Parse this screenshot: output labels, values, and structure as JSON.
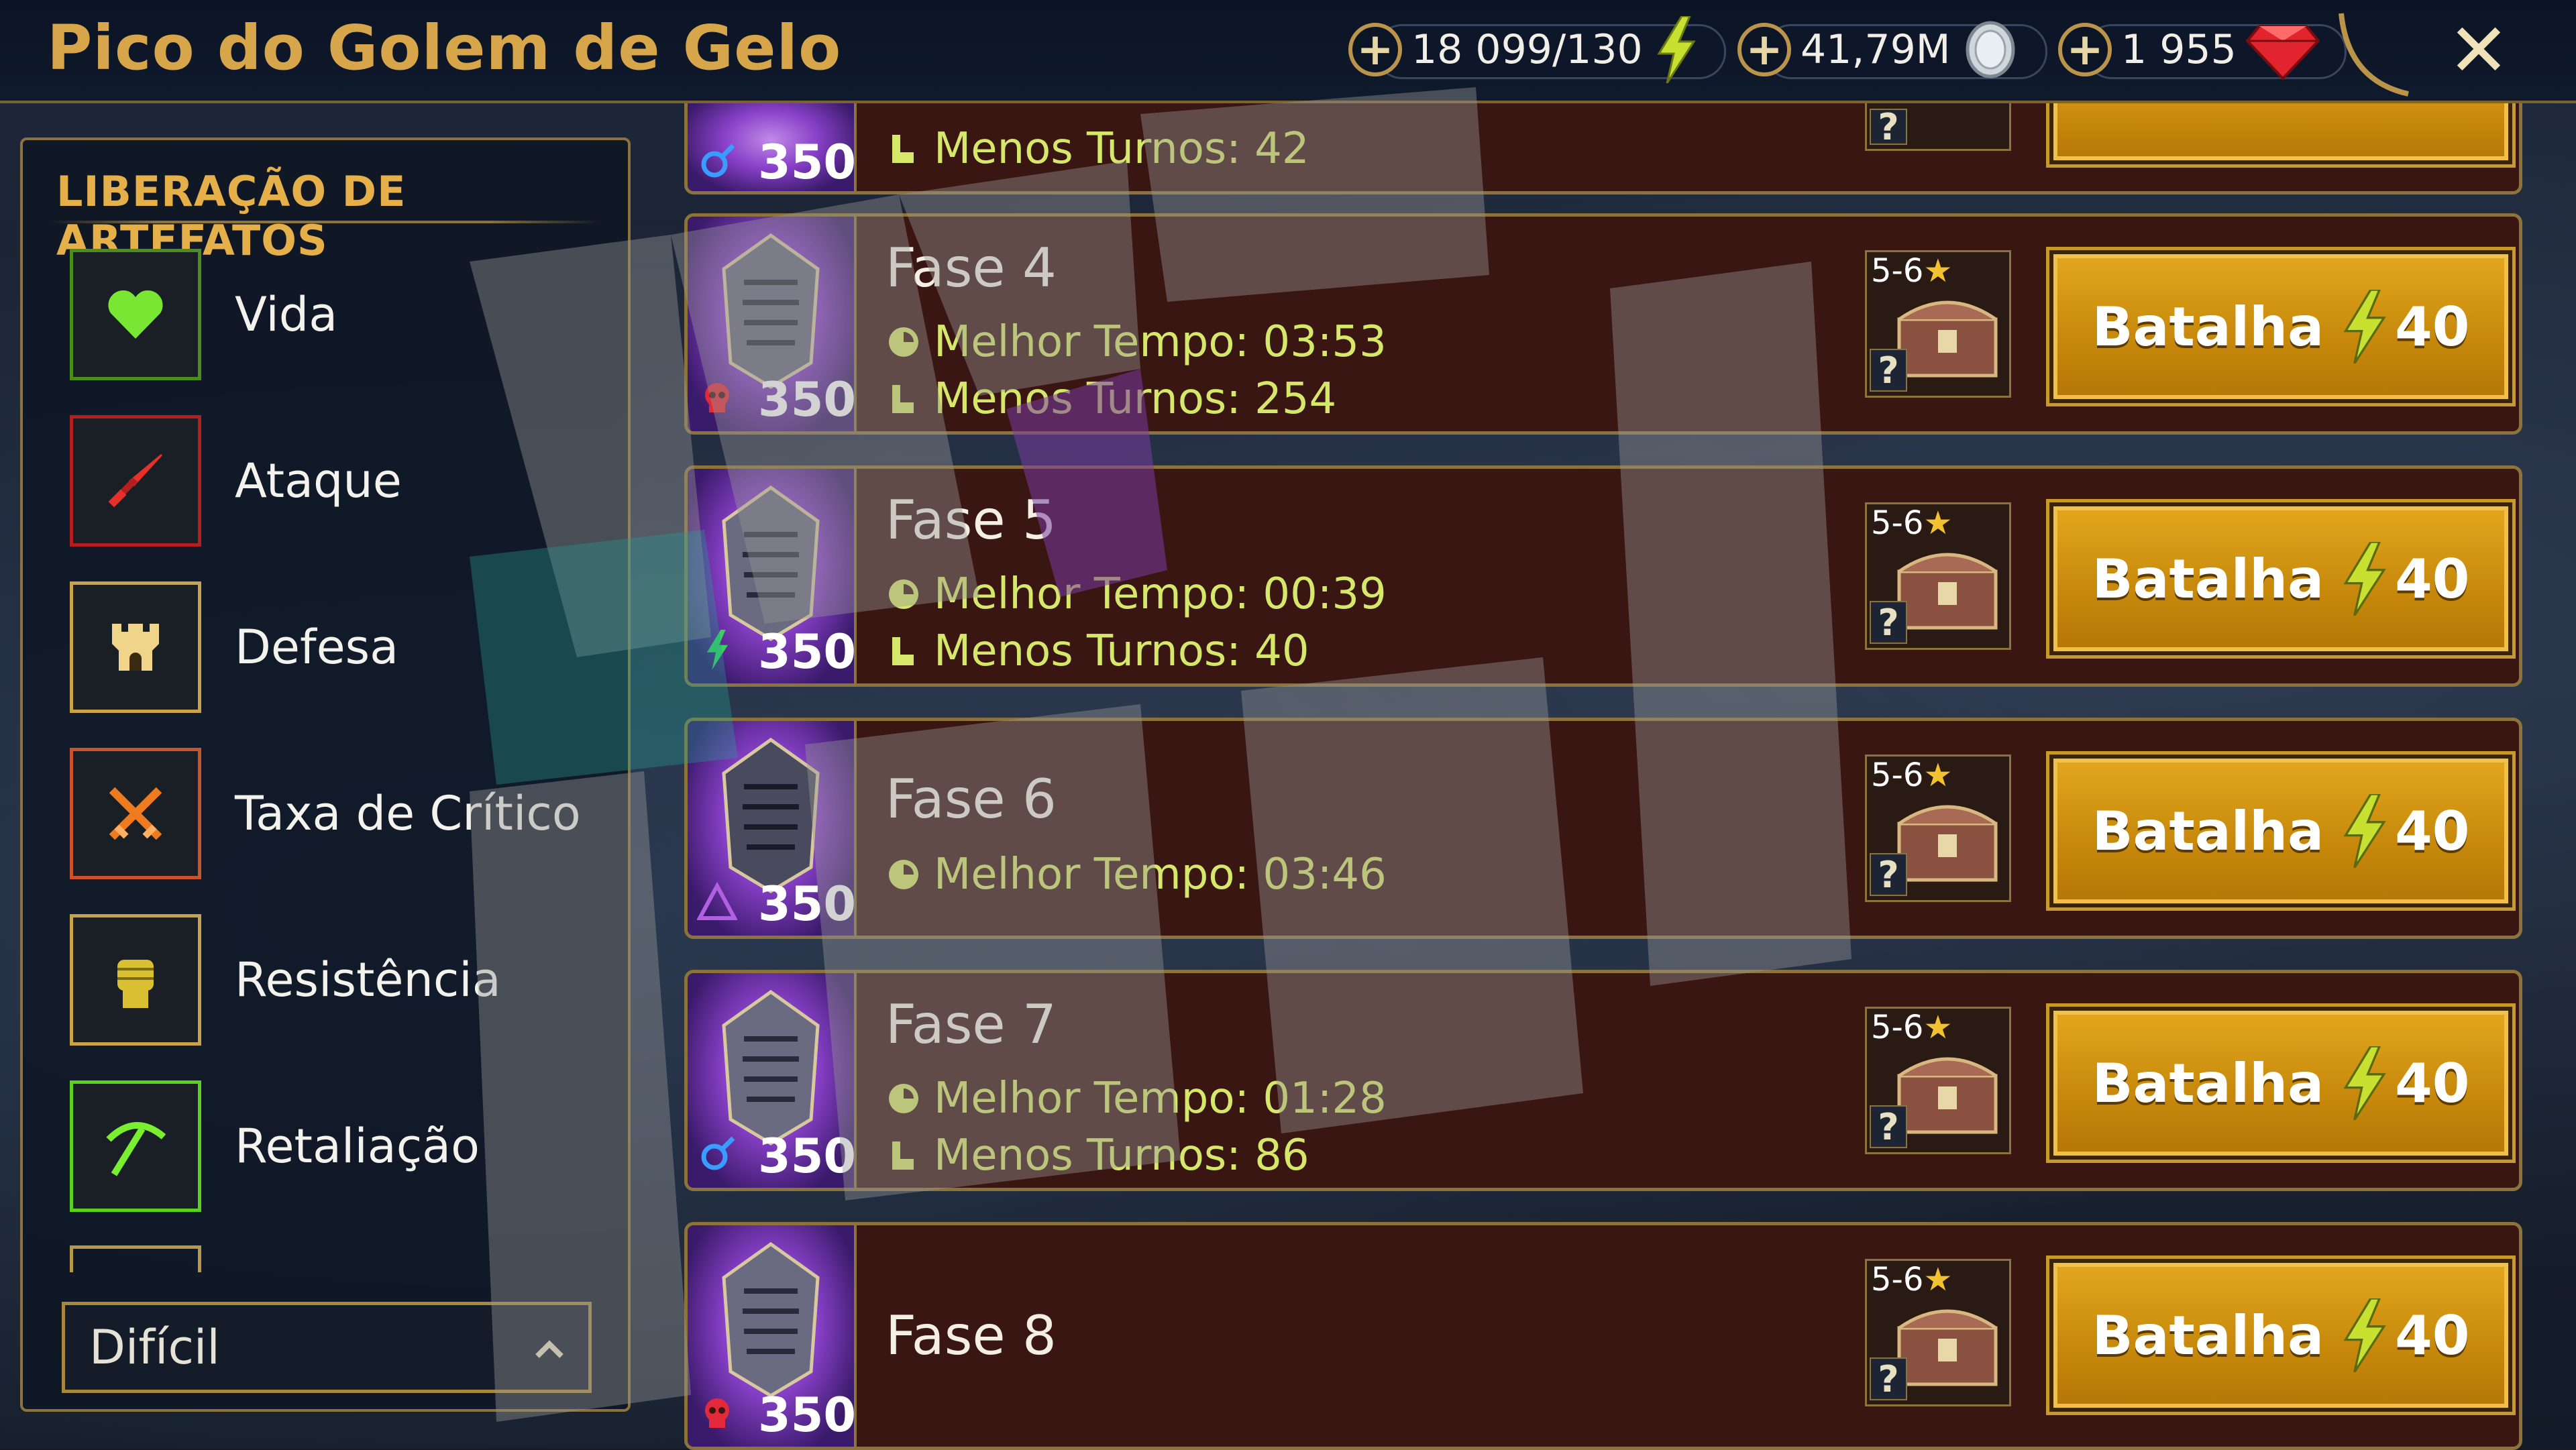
{
  "header": {
    "title": "Pico do Golem de Gelo",
    "resources": [
      {
        "value": "18 099/130",
        "icon": "energy-bolt-icon"
      },
      {
        "value": "41,79M",
        "icon": "silver-coin-icon"
      },
      {
        "value": "1 955",
        "icon": "gem-icon"
      }
    ],
    "close_label": "✕"
  },
  "sidebar": {
    "title": "LIBERAÇÃO DE ARTEFATOS",
    "filters": [
      {
        "label": "Vida",
        "icon": "heart-icon",
        "border": "#4a8f1e"
      },
      {
        "label": "Ataque",
        "icon": "sword-icon",
        "border": "#b51e1e"
      },
      {
        "label": "Defesa",
        "icon": "tower-icon",
        "border": "#c9a24a"
      },
      {
        "label": "Taxa de Crítico",
        "icon": "crossed-swords-icon",
        "border": "#c9532a"
      },
      {
        "label": "Resistência",
        "icon": "fist-icon",
        "border": "#c9a24a"
      },
      {
        "label": "Retaliação",
        "icon": "pickaxe-icon",
        "border": "#5ad11e"
      }
    ],
    "difficulty": "Difícil"
  },
  "stages": [
    {
      "name": "",
      "power": "350",
      "affinity": "magic",
      "best_time": "",
      "min_turns": "Menos Turnos: 42"
    },
    {
      "name": "Fase 4",
      "power": "350",
      "affinity": "void",
      "best_time": "Melhor Tempo: 03:53",
      "min_turns": "Menos Turnos: 254",
      "rank": "5-6",
      "battle": "Batalha",
      "cost": "40"
    },
    {
      "name": "Fase 5",
      "power": "350",
      "affinity": "spirit",
      "best_time": "Melhor Tempo: 00:39",
      "min_turns": "Menos Turnos: 40",
      "rank": "5-6",
      "battle": "Batalha",
      "cost": "40"
    },
    {
      "name": "Fase 6",
      "power": "350",
      "affinity": "force",
      "best_time": "Melhor Tempo: 03:46",
      "min_turns": "",
      "rank": "5-6",
      "battle": "Batalha",
      "cost": "40"
    },
    {
      "name": "Fase 7",
      "power": "350",
      "affinity": "magic",
      "best_time": "Melhor Tempo: 01:28",
      "min_turns": "Menos Turnos: 86",
      "rank": "5-6",
      "battle": "Batalha",
      "cost": "40"
    },
    {
      "name": "Fase 8",
      "power": "350",
      "affinity": "void",
      "best_time": "",
      "min_turns": "",
      "rank": "5-6",
      "battle": "Batalha",
      "cost": "40"
    }
  ],
  "colors": {
    "gold": "#d7a54a",
    "stat_text": "#d6e86a",
    "battle_button": "#d9a016",
    "stage_bg": "#3a1612"
  }
}
